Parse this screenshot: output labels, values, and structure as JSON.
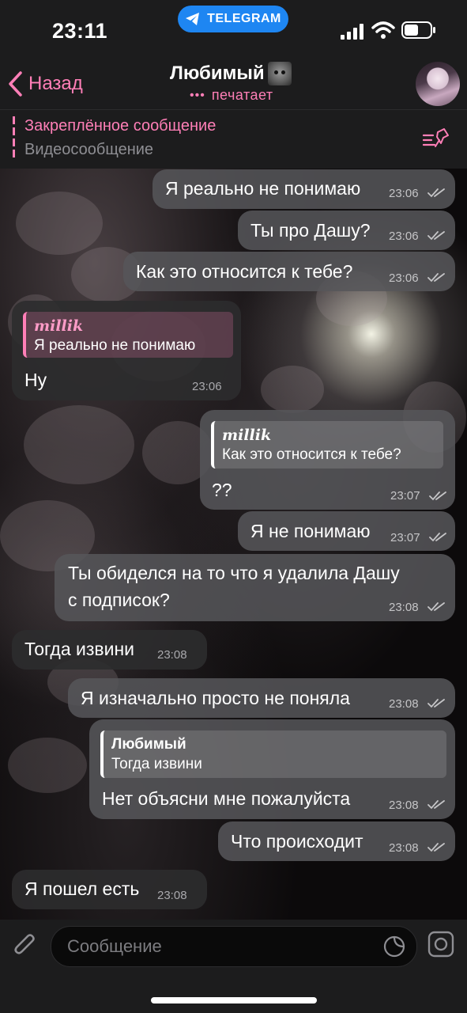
{
  "status_bar": {
    "time": "23:11",
    "pill_label": "TELEGRAM"
  },
  "nav": {
    "back_label": "Назад",
    "chat_name": "Любимый",
    "typing_dots": "•••",
    "typing_status": "печатает"
  },
  "pinned": {
    "title": "Закреплённое сообщение",
    "subtitle": "Видеосообщение"
  },
  "messages": [
    {
      "dir": "out",
      "text": "Я реально не понимаю",
      "time": "23:06",
      "read": true
    },
    {
      "dir": "out",
      "text": "Ты про Дашу?",
      "time": "23:06",
      "read": true
    },
    {
      "dir": "out",
      "text": "Как это относится к тебе?",
      "time": "23:06",
      "read": true
    },
    {
      "dir": "in",
      "reply_name": "millik",
      "reply_text": "Я реально не понимаю",
      "text": "Ну",
      "time": "23:06"
    },
    {
      "dir": "out",
      "reply_name": "millik",
      "reply_text": "Как это относится к тебе?",
      "text": "??",
      "time": "23:07",
      "read": true
    },
    {
      "dir": "out",
      "text": "Я не понимаю",
      "time": "23:07",
      "read": true
    },
    {
      "dir": "out",
      "text_line1": "Ты обиделся на то что я удалила Дашу",
      "text_line2": "с подписок?",
      "time": "23:08",
      "read": true
    },
    {
      "dir": "in",
      "text": "Тогда извини",
      "time": "23:08"
    },
    {
      "dir": "out",
      "text": "Я изначально просто не поняла",
      "time": "23:08",
      "read": true
    },
    {
      "dir": "out",
      "reply_name": "Любимый",
      "reply_text": "Тогда извини",
      "text": "Нет объясни мне пожалуйста",
      "time": "23:08",
      "read": true
    },
    {
      "dir": "out",
      "text": "Что происходит",
      "time": "23:08",
      "read": true
    },
    {
      "dir": "in",
      "text": "Я пошел есть",
      "time": "23:08"
    }
  ],
  "input": {
    "placeholder": "Сообщение"
  },
  "colors": {
    "accent": "#ff7fb7",
    "pill": "#1e86f2",
    "bar_bg": "#1c1c1d",
    "out_bubble": "#56565a",
    "in_bubble": "#2c2c2e"
  },
  "icons": [
    "telegram-icon",
    "signal-icon",
    "wifi-icon",
    "battery-icon",
    "chevron-left-icon",
    "cat-emoji-icon",
    "pinned-list-icon",
    "read-check-icon",
    "paperclip-icon",
    "sticker-icon",
    "camera-icon"
  ]
}
